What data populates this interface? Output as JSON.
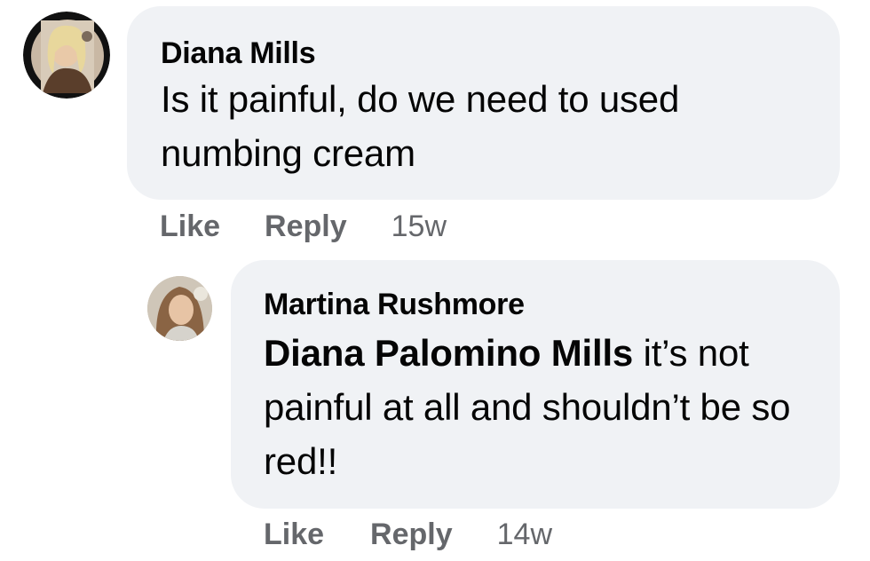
{
  "comments": [
    {
      "author": "Diana Mills",
      "text": "Is it painful, do we need to used numbing cream",
      "like_label": "Like",
      "reply_label": "Reply",
      "time": "15w"
    },
    {
      "author": "Martina Rushmore",
      "mention": "Diana Palomino Mills",
      "text": " it’s not painful at all and shouldn’t be so red!!",
      "like_label": "Like",
      "reply_label": "Reply",
      "time": "14w"
    }
  ],
  "colors": {
    "bubble": "#f0f2f5",
    "text": "#050505",
    "meta": "#65676b"
  }
}
